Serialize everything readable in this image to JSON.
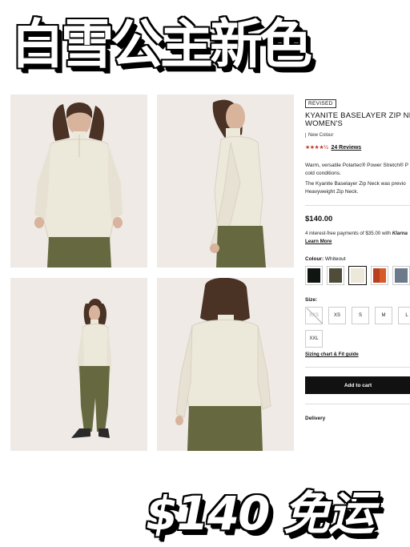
{
  "overlay": {
    "top_caption": "白雪公主新色",
    "bottom_caption": "$140 免运"
  },
  "product": {
    "badge": "REVISED",
    "title_line1": "KYANITE BASELAYER ZIP NE",
    "title_line2": "WOMEN'S",
    "colour_tag": "New Colour",
    "stars": "★★★★½",
    "reviews_label": "24 Reviews",
    "desc_line1": "Warm, versatile Polartec® Power Stretch® P",
    "desc_line2": "cold conditions.",
    "desc2_line1": "The Kyanite Baselayer Zip Neck was previo",
    "desc2_line2": "Heavyweight Zip Neck.",
    "price": "$140.00",
    "instalment_text": "4 interest-free payments of $35.00 with",
    "instalment_brand": "Klarna",
    "learn_more": "Learn More",
    "colour_label": "Colour:",
    "colour_value": "Whiteout",
    "swatch_colors": [
      "#111512",
      "#4f4c39",
      "#ece8da",
      "#b8401f",
      "#6d7a8c"
    ],
    "size_label": "Size:",
    "sizes": [
      "XXS",
      "XS",
      "S",
      "M",
      "L",
      "XXL"
    ],
    "size_guide": "Sizing chart & Fit guide",
    "cart_button": "Add to cart",
    "delivery_label": "Delivery"
  },
  "colors": {
    "garment_top": "#ece8da",
    "garment_pants": "#66693f",
    "background": "#efeae6"
  }
}
